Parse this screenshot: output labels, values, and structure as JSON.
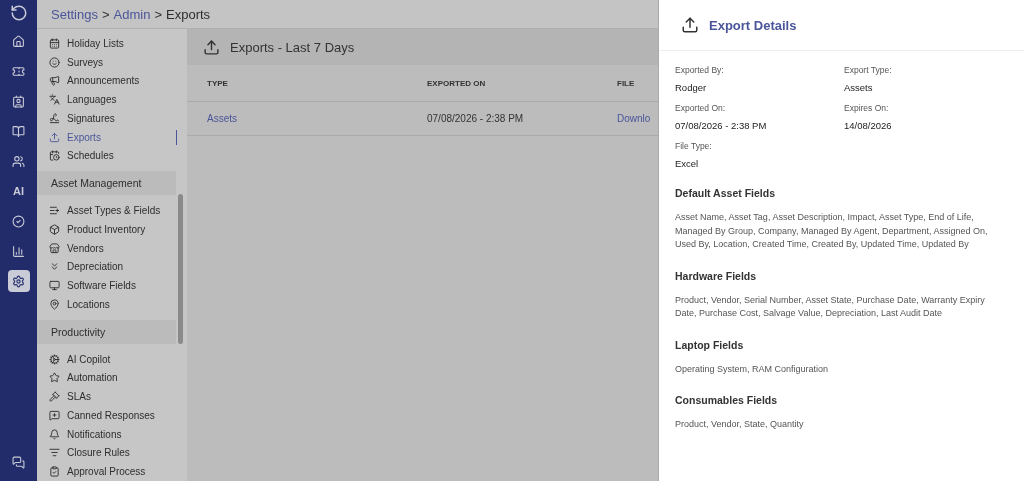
{
  "rail": {
    "items": [
      {
        "selected": false
      },
      {
        "selected": false
      },
      {
        "selected": false
      },
      {
        "selected": false
      },
      {
        "selected": false
      },
      {
        "label": "AI",
        "selected": false
      },
      {
        "selected": false
      },
      {
        "selected": false
      },
      {
        "selected": true
      }
    ]
  },
  "breadcrumb": [
    {
      "label": "Settings",
      "link": true,
      "separator": ">"
    },
    {
      "label": "Admin",
      "link": true,
      "separator": ">"
    },
    {
      "label": "Exports",
      "link": false
    }
  ],
  "sidebar": {
    "sections": [
      {
        "items": [
          {
            "label": "Holiday Lists",
            "selected": false
          },
          {
            "label": "Surveys",
            "selected": false
          },
          {
            "label": "Announcements",
            "selected": false
          },
          {
            "label": "Languages",
            "selected": false
          },
          {
            "label": "Signatures",
            "selected": false
          },
          {
            "label": "Exports",
            "selected": true
          },
          {
            "label": "Schedules",
            "selected": false
          }
        ]
      },
      {
        "title": "Asset Management",
        "items": [
          {
            "label": "Asset Types & Fields",
            "selected": false
          },
          {
            "label": "Product Inventory",
            "selected": false
          },
          {
            "label": "Vendors",
            "selected": false
          },
          {
            "label": "Depreciation",
            "selected": false
          },
          {
            "label": "Software Fields",
            "selected": false
          },
          {
            "label": "Locations",
            "selected": false
          }
        ]
      },
      {
        "title": "Productivity",
        "items": [
          {
            "label": "AI Copilot",
            "selected": false
          },
          {
            "label": "Automation",
            "selected": false
          },
          {
            "label": "SLAs",
            "selected": false
          },
          {
            "label": "Canned Responses",
            "selected": false
          },
          {
            "label": "Notifications",
            "selected": false
          },
          {
            "label": "Closure Rules",
            "selected": false
          },
          {
            "label": "Approval Process",
            "selected": false
          }
        ]
      }
    ]
  },
  "exports": {
    "title": "Exports - Last 7 Days",
    "columns": [
      "TYPE",
      "EXPORTED ON",
      "FILE"
    ],
    "rows": [
      {
        "type": "Assets",
        "exported_on": "07/08/2026 - 2:38 PM",
        "file": "Downlo"
      }
    ]
  },
  "details": {
    "title": "Export Details",
    "fields": [
      {
        "label": "Exported By:",
        "value": "Rodger"
      },
      {
        "label": "Export Type:",
        "value": "Assets"
      },
      {
        "label": "Exported On:",
        "value": "07/08/2026 - 2:38 PM"
      },
      {
        "label": "Expires On:",
        "value": "14/08/2026"
      },
      {
        "label": "File Type:",
        "value": "Excel"
      }
    ],
    "sections": [
      {
        "title": "Default Asset Fields",
        "text": "Asset Name, Asset Tag, Asset Description, Impact, Asset Type, End of Life, Managed By Group, Company, Managed By Agent, Department, Assigned On, Used By, Location, Created Time, Created By, Updated Time, Updated By"
      },
      {
        "title": "Hardware Fields",
        "text": "Product, Vendor, Serial Number, Asset State, Purchase Date, Warranty Expiry Date, Purchase Cost, Salvage Value, Depreciation, Last Audit Date"
      },
      {
        "title": "Laptop Fields",
        "text": "Operating System, RAM Configuration"
      },
      {
        "title": "Consumables Fields",
        "text": "Product, Vendor, State, Quantity"
      }
    ]
  }
}
